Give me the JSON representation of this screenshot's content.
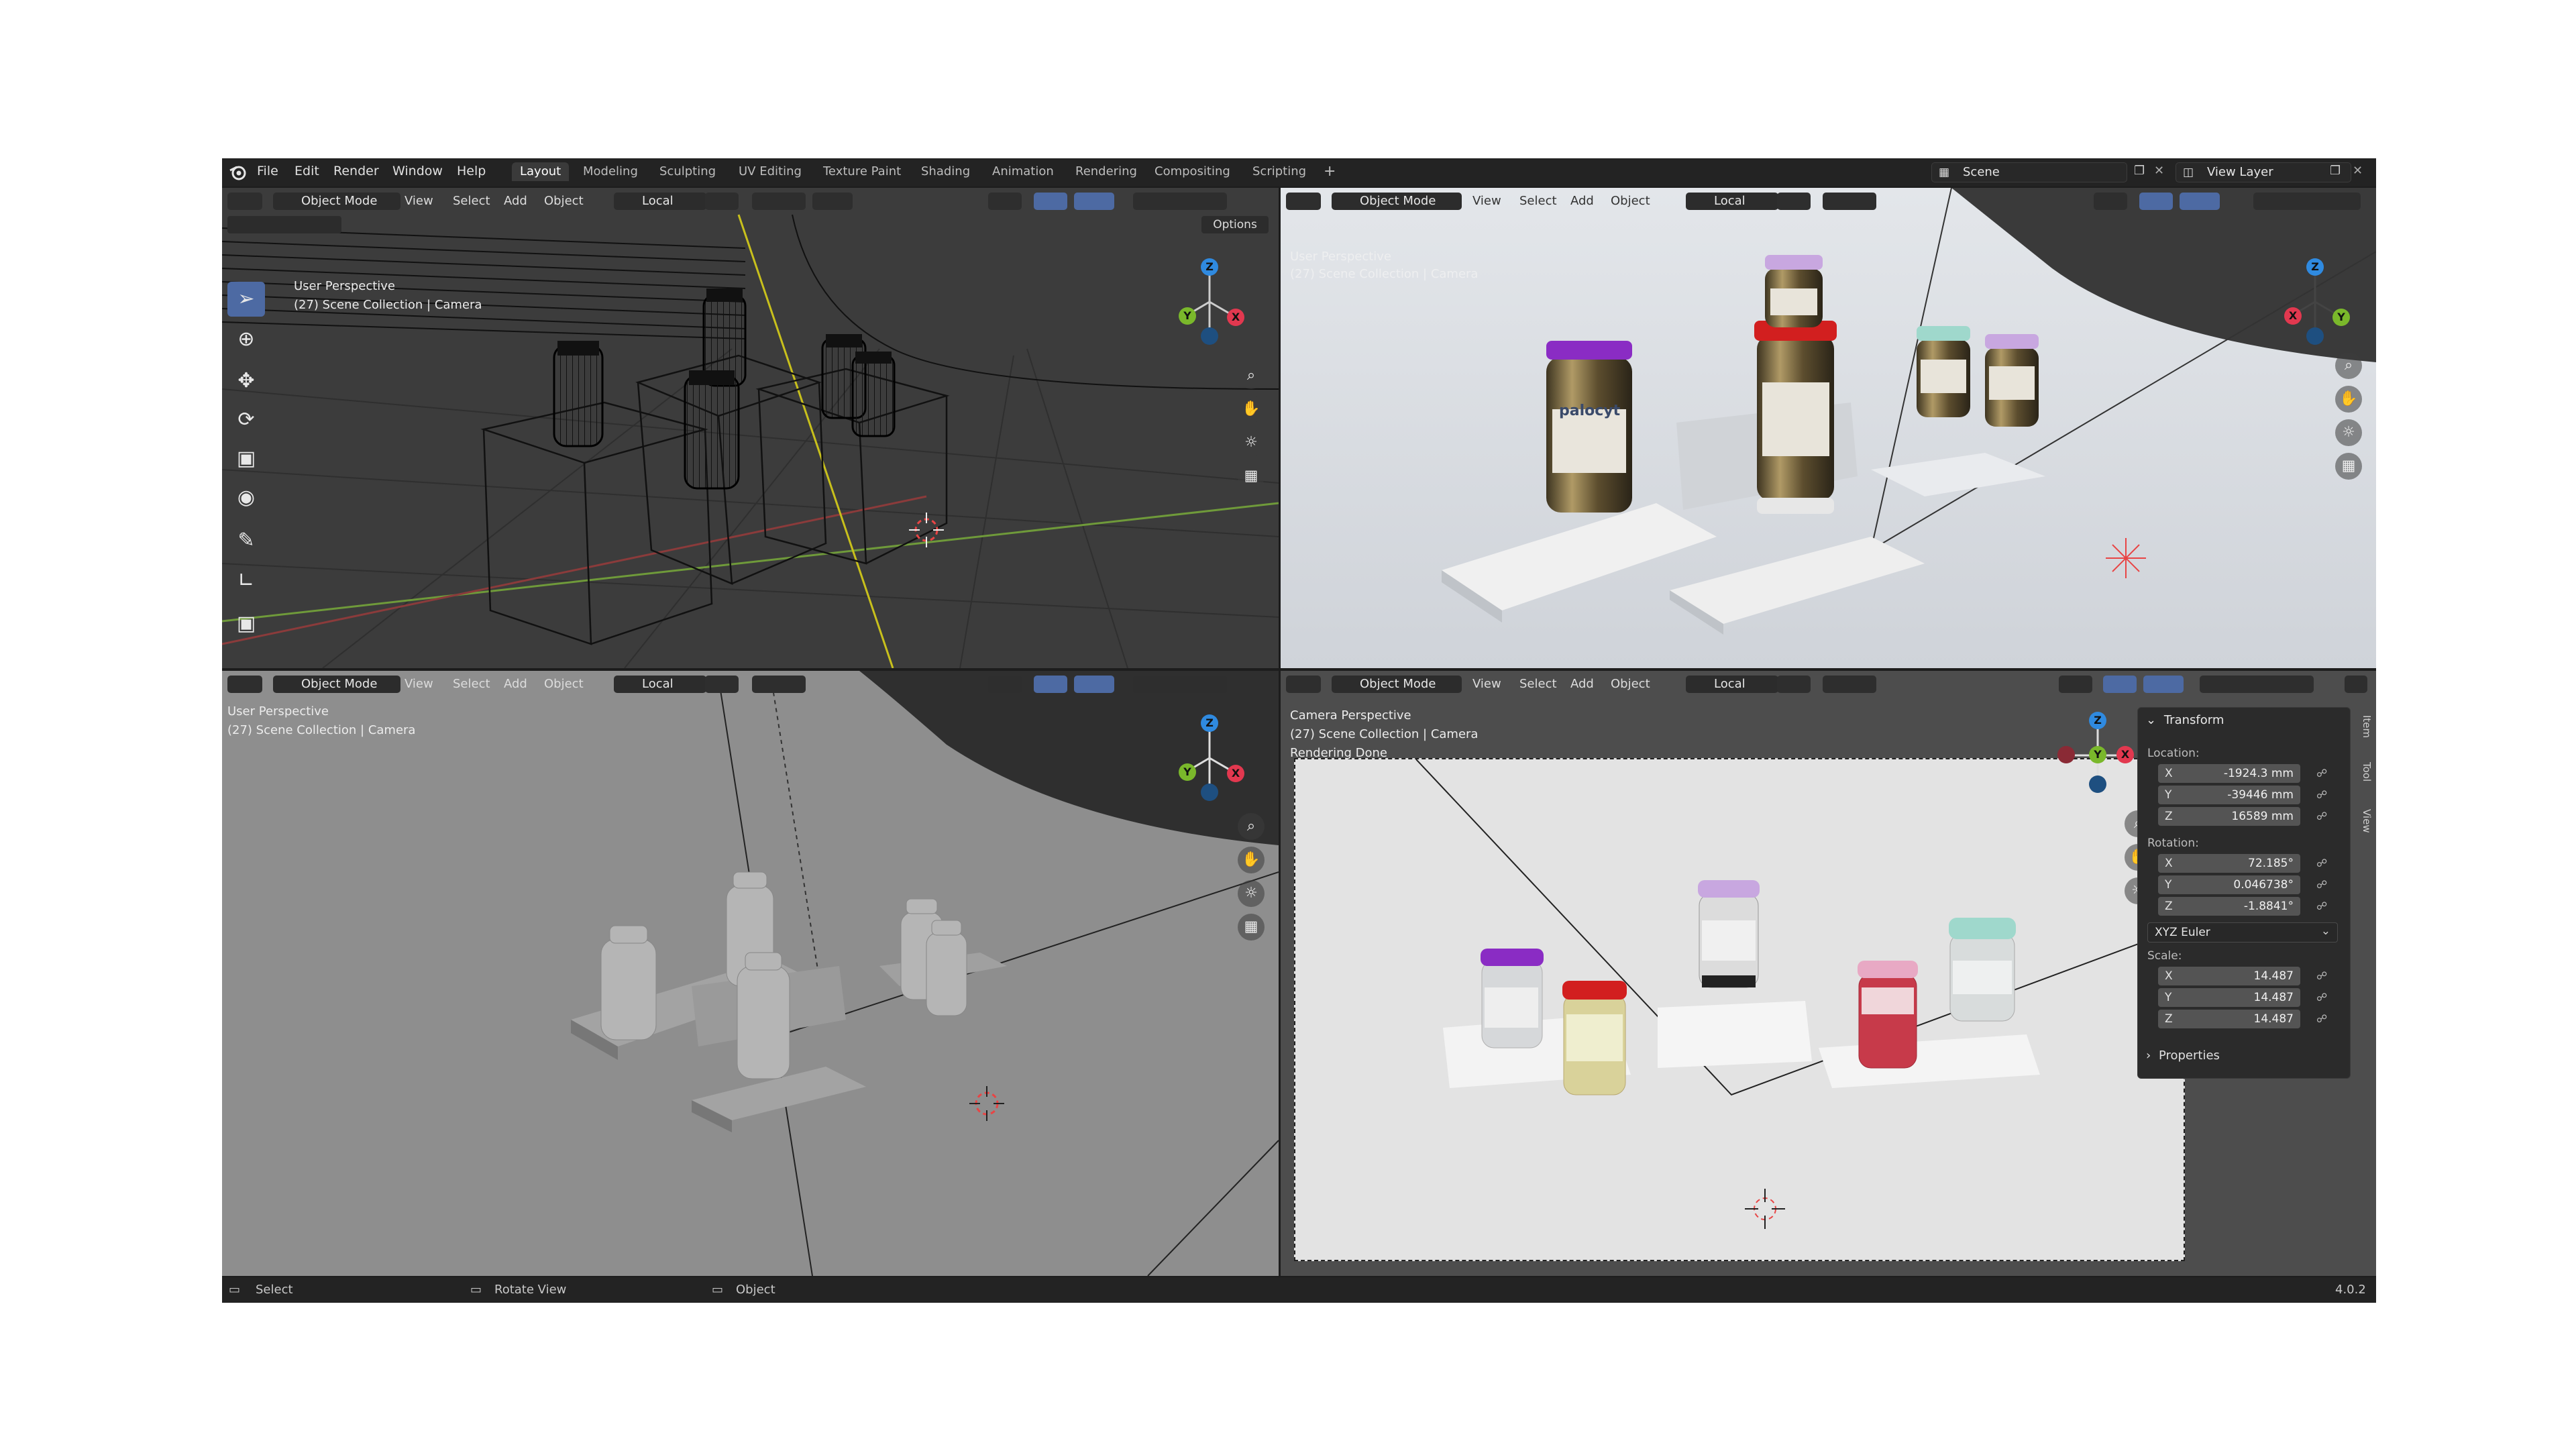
{
  "menu": [
    "File",
    "Edit",
    "Render",
    "Window",
    "Help"
  ],
  "workspaces": [
    "Layout",
    "Modeling",
    "Sculpting",
    "UV Editing",
    "Texture Paint",
    "Shading",
    "Animation",
    "Rendering",
    "Compositing",
    "Scripting"
  ],
  "active_workspace": "Layout",
  "add_workspace": "+",
  "scene_name": "Scene",
  "view_layer": "View Layer",
  "header": {
    "mode": "Object Mode",
    "view": "View",
    "select": "Select",
    "add": "Add",
    "object": "Object",
    "pivot": "Local",
    "options": "Options"
  },
  "viewports": {
    "top_left": {
      "line1": "User Perspective",
      "line2": "(27) Scene Collection | Camera",
      "shading": "wireframe"
    },
    "top_right": {
      "line1": "User Perspective",
      "line2": "(27) Scene Collection | Camera",
      "shading": "rendered"
    },
    "bottom_left": {
      "line1": "User Perspective",
      "line2": "(27) Scene Collection | Camera",
      "shading": "solid"
    },
    "bottom_right": {
      "line1": "Camera Perspective",
      "line2": "(27) Scene Collection | Camera",
      "line3": "Rendering Done",
      "shading": "rendered"
    }
  },
  "gizmo": {
    "x": "X",
    "y": "Y",
    "z": "Z",
    "x_color": "#e2384f",
    "y_color": "#7ab82b",
    "z_color": "#2f8ae0"
  },
  "vial_labels": {
    "label_a": "palocyt",
    "label_b": "palocyt"
  },
  "npanel": {
    "title": "Transform",
    "location_label": "Location:",
    "location": [
      {
        "axis": "X",
        "value": "-1924.3 mm"
      },
      {
        "axis": "Y",
        "value": "-39446 mm"
      },
      {
        "axis": "Z",
        "value": "16589 mm"
      }
    ],
    "rotation_label": "Rotation:",
    "rotation": [
      {
        "axis": "X",
        "value": "72.185°"
      },
      {
        "axis": "Y",
        "value": "0.046738°"
      },
      {
        "axis": "Z",
        "value": "-1.8841°"
      }
    ],
    "rotation_mode": "XYZ Euler",
    "scale_label": "Scale:",
    "scale": [
      {
        "axis": "X",
        "value": "14.487"
      },
      {
        "axis": "Y",
        "value": "14.487"
      },
      {
        "axis": "Z",
        "value": "14.487"
      }
    ],
    "properties": "Properties",
    "tabs": [
      "Item",
      "Tool",
      "View"
    ]
  },
  "statusbar": {
    "select": "Select",
    "rotate": "Rotate View",
    "object": "Object",
    "version": "4.0.2"
  },
  "colors": {
    "cap_purple": "#8a2cc4",
    "cap_red": "#d21f1f",
    "cap_lilac": "#c8a7e0",
    "cap_mint": "#9fd8cc",
    "cap_pink": "#e8a9c4",
    "accent": "#4d6aa3"
  }
}
